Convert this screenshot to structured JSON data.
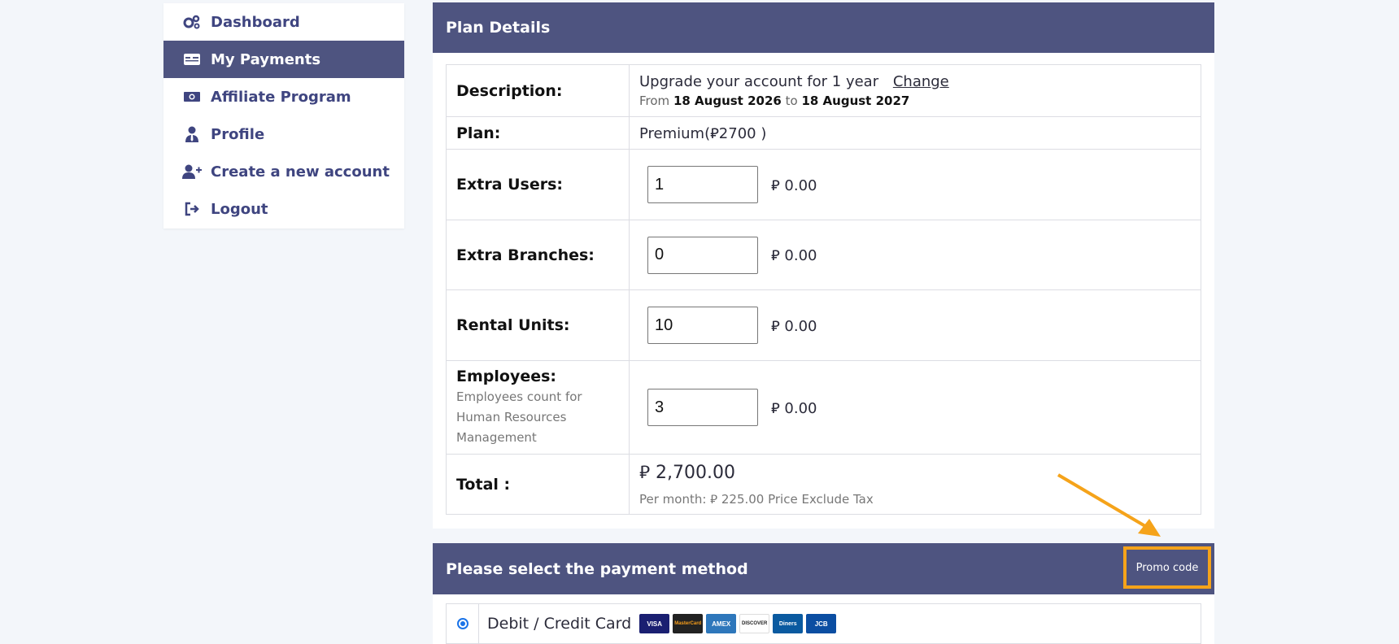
{
  "sidebar": {
    "items": [
      {
        "label": "Dashboard",
        "icon": "gears-icon",
        "active": false
      },
      {
        "label": "My Payments",
        "icon": "payment-card-icon",
        "active": true
      },
      {
        "label": "Affiliate Program",
        "icon": "money-icon",
        "active": false
      },
      {
        "label": "Profile",
        "icon": "user-tie-icon",
        "active": false
      },
      {
        "label": "Create a new account",
        "icon": "user-plus-icon",
        "active": false
      },
      {
        "label": "Logout",
        "icon": "sign-out-icon",
        "active": false
      }
    ]
  },
  "plan": {
    "header": "Plan Details",
    "description_label": "Description:",
    "description_value": "Upgrade your account for 1 year",
    "change_label": "Change",
    "from_label": "From",
    "from_date": "18 August 2026",
    "to_label": "to",
    "to_date": "18 August 2027",
    "plan_label": "Plan:",
    "plan_value": "Premium(⃁2700 )",
    "extra_users_label": "Extra Users:",
    "extra_users_value": "1",
    "extra_users_price": "⃁ 0.00",
    "extra_branches_label": "Extra Branches:",
    "extra_branches_value": "0",
    "extra_branches_price": "⃁ 0.00",
    "rental_units_label": "Rental Units:",
    "rental_units_value": "10",
    "rental_units_price": "⃁ 0.00",
    "employees_label": "Employees:",
    "employees_note": "Employees count for Human Resources Management",
    "employees_value": "3",
    "employees_price": "⃁ 0.00",
    "total_label": "Total :",
    "total_value": "⃁ 2,700.00",
    "per_month": "Per month: ⃁ 225.00 Price Exclude Tax"
  },
  "payment": {
    "header": "Please select the payment method",
    "promo_label": "Promo code",
    "method_label": "Debit / Credit Card",
    "cards": [
      "VISA",
      "MasterCard",
      "AMEX",
      "DISCOVER",
      "Diners",
      "JCB"
    ]
  },
  "colors": {
    "accent": "#4e5480",
    "highlight": "#f5a31a",
    "radio": "#1a73e8"
  }
}
